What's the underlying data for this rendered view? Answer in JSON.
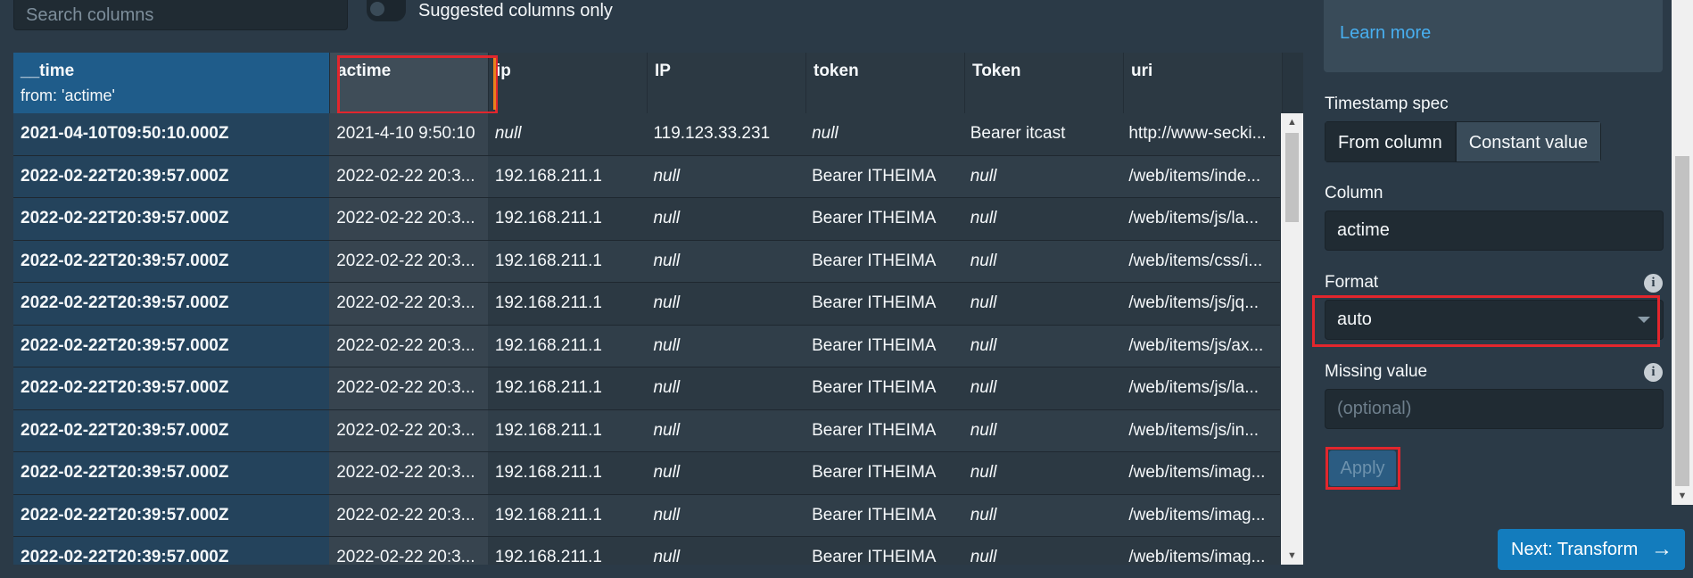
{
  "toolbar": {
    "search_placeholder": "Search columns",
    "suggested_label": "Suggested columns only"
  },
  "table": {
    "headers": {
      "time": "__time",
      "time_sub": "from: 'actime'",
      "actime": "actime",
      "ip": "ip",
      "IP": "IP",
      "token": "token",
      "Token": "Token",
      "uri": "uri"
    },
    "rows": [
      {
        "time": "2021-04-10T09:50:10.000Z",
        "actime": "2021-4-10 9:50:10",
        "ip": "null",
        "IP": "119.123.33.231",
        "token": "null",
        "Token": "Bearer itcast",
        "uri": "http://www-secki..."
      },
      {
        "time": "2022-02-22T20:39:57.000Z",
        "actime": "2022-02-22 20:3...",
        "ip": "192.168.211.1",
        "IP": "null",
        "token": "Bearer ITHEIMA",
        "Token": "null",
        "uri": "/web/items/inde..."
      },
      {
        "time": "2022-02-22T20:39:57.000Z",
        "actime": "2022-02-22 20:3...",
        "ip": "192.168.211.1",
        "IP": "null",
        "token": "Bearer ITHEIMA",
        "Token": "null",
        "uri": "/web/items/js/la..."
      },
      {
        "time": "2022-02-22T20:39:57.000Z",
        "actime": "2022-02-22 20:3...",
        "ip": "192.168.211.1",
        "IP": "null",
        "token": "Bearer ITHEIMA",
        "Token": "null",
        "uri": "/web/items/css/i..."
      },
      {
        "time": "2022-02-22T20:39:57.000Z",
        "actime": "2022-02-22 20:3...",
        "ip": "192.168.211.1",
        "IP": "null",
        "token": "Bearer ITHEIMA",
        "Token": "null",
        "uri": "/web/items/js/jq..."
      },
      {
        "time": "2022-02-22T20:39:57.000Z",
        "actime": "2022-02-22 20:3...",
        "ip": "192.168.211.1",
        "IP": "null",
        "token": "Bearer ITHEIMA",
        "Token": "null",
        "uri": "/web/items/js/ax..."
      },
      {
        "time": "2022-02-22T20:39:57.000Z",
        "actime": "2022-02-22 20:3...",
        "ip": "192.168.211.1",
        "IP": "null",
        "token": "Bearer ITHEIMA",
        "Token": "null",
        "uri": "/web/items/js/la..."
      },
      {
        "time": "2022-02-22T20:39:57.000Z",
        "actime": "2022-02-22 20:3...",
        "ip": "192.168.211.1",
        "IP": "null",
        "token": "Bearer ITHEIMA",
        "Token": "null",
        "uri": "/web/items/js/in..."
      },
      {
        "time": "2022-02-22T20:39:57.000Z",
        "actime": "2022-02-22 20:3...",
        "ip": "192.168.211.1",
        "IP": "null",
        "token": "Bearer ITHEIMA",
        "Token": "null",
        "uri": "/web/items/imag..."
      },
      {
        "time": "2022-02-22T20:39:57.000Z",
        "actime": "2022-02-22 20:3...",
        "ip": "192.168.211.1",
        "IP": "null",
        "token": "Bearer ITHEIMA",
        "Token": "null",
        "uri": "/web/items/imag..."
      },
      {
        "time": "2022-02-22T20:39:57.000Z",
        "actime": "2022-02-22 20:3...",
        "ip": "192.168.211.1",
        "IP": "null",
        "token": "Bearer ITHEIMA",
        "Token": "null",
        "uri": "/web/items/imag..."
      }
    ]
  },
  "panel": {
    "learn_more": "Learn more",
    "timestamp_spec_label": "Timestamp spec",
    "spec_options": [
      "From column",
      "Constant value"
    ],
    "spec_selected": "Constant value",
    "column_label": "Column",
    "column_value": "actime",
    "format_label": "Format",
    "format_value": "auto",
    "missing_label": "Missing value",
    "missing_placeholder": "(optional)",
    "apply_label": "Apply",
    "next_label": "Next: Transform",
    "info_icon": "i",
    "next_arrow": "→"
  },
  "icons": {
    "info": "info-icon",
    "next": "arrow-right-icon",
    "caret": "caret-down-icon"
  },
  "colors": {
    "background": "#2b3a47",
    "time_header": "#1f5c8a",
    "primary_button": "#137cbd",
    "link": "#48aff0",
    "highlight": "#e2262d"
  }
}
